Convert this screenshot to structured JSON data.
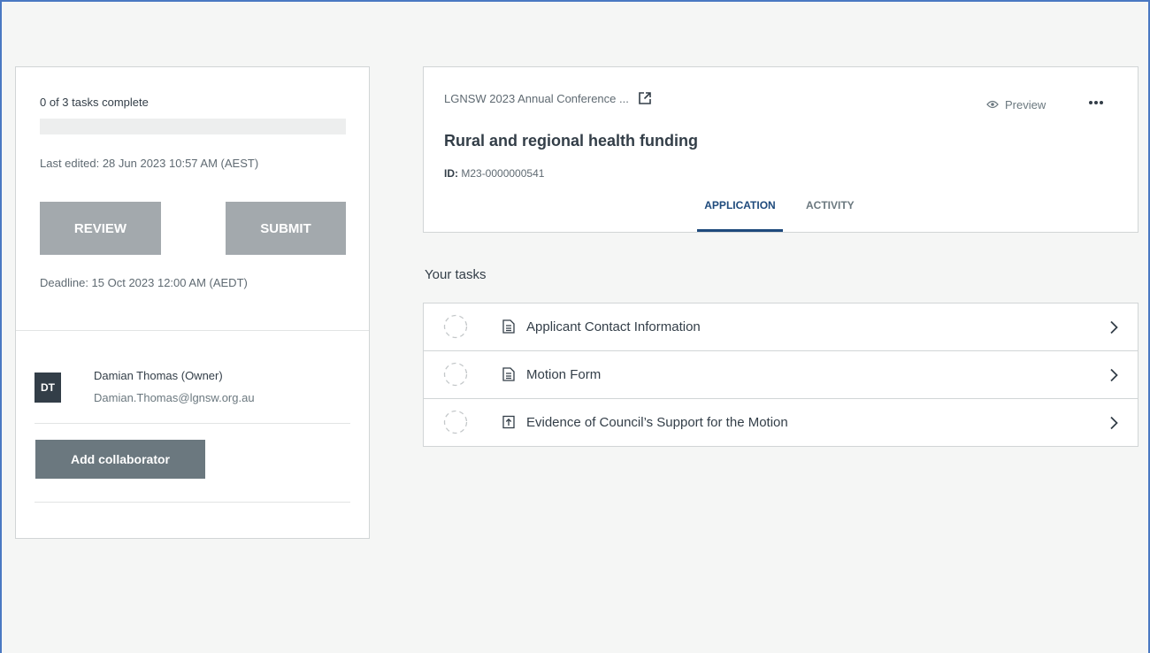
{
  "summary": {
    "progress_text": "0 of 3 tasks complete",
    "progress_fraction": 0,
    "last_edited": "Last edited: 28 Jun 2023 10:57 AM (AEST)",
    "review_label": "REVIEW",
    "submit_label": "SUBMIT",
    "deadline": "Deadline: 15 Oct 2023 12:00 AM (AEDT)"
  },
  "collaborators": {
    "owner_initials": "DT",
    "owner_name": "Damian Thomas (Owner)",
    "owner_email": "Damian.Thomas@lgnsw.org.au",
    "add_label": "Add collaborator"
  },
  "header": {
    "breadcrumb": "LGNSW 2023 Annual Conference ...",
    "preview_label": "Preview",
    "title": "Rural and regional health funding",
    "id_label": "ID:",
    "id_value": "M23-0000000541",
    "tabs": [
      "APPLICATION",
      "ACTIVITY"
    ]
  },
  "tasks": {
    "heading": "Your tasks",
    "items": [
      {
        "label": "Applicant Contact Information",
        "icon": "document-icon"
      },
      {
        "label": "Motion Form",
        "icon": "document-icon"
      },
      {
        "label": "Evidence of Council’s Support for the Motion",
        "icon": "upload-icon"
      }
    ]
  },
  "colors": {
    "accent": "#1e4a7c",
    "disabled_button": "#a3a9ad",
    "secondary_button": "#6b787f",
    "frame": "#4a78c2"
  }
}
